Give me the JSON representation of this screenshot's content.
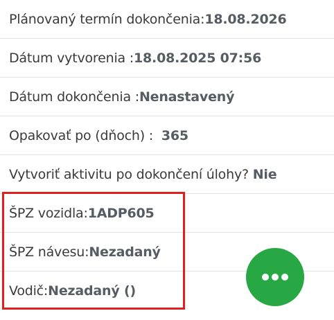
{
  "details": {
    "planned_completion": {
      "label": "Plánovaný termín dokončenia: ",
      "value": "18.08.2026"
    },
    "created_date": {
      "label": "Dátum vytvorenia : ",
      "value": "18.08.2025 07:56"
    },
    "completion_date": {
      "label": "Dátum dokončenia : ",
      "value": "Nenastavený"
    },
    "repeat_after": {
      "label": "Opakovať po (dňoch) : ",
      "value": "365"
    },
    "create_activity": {
      "label": "Vytvoriť aktivitu po dokončení úlohy? ",
      "value": "Nie"
    },
    "vehicle_plate": {
      "label": "ŠPZ vozidla:",
      "value": "1ADP605"
    },
    "trailer_plate": {
      "label": "ŠPZ návesu:",
      "value": "Nezadaný"
    },
    "driver": {
      "label": "Vodič:",
      "value": "Nezadaný ()"
    }
  },
  "fab": {
    "icon": "more-horizontal-icon",
    "color": "#27a844"
  },
  "highlight_color": "#e0201e"
}
